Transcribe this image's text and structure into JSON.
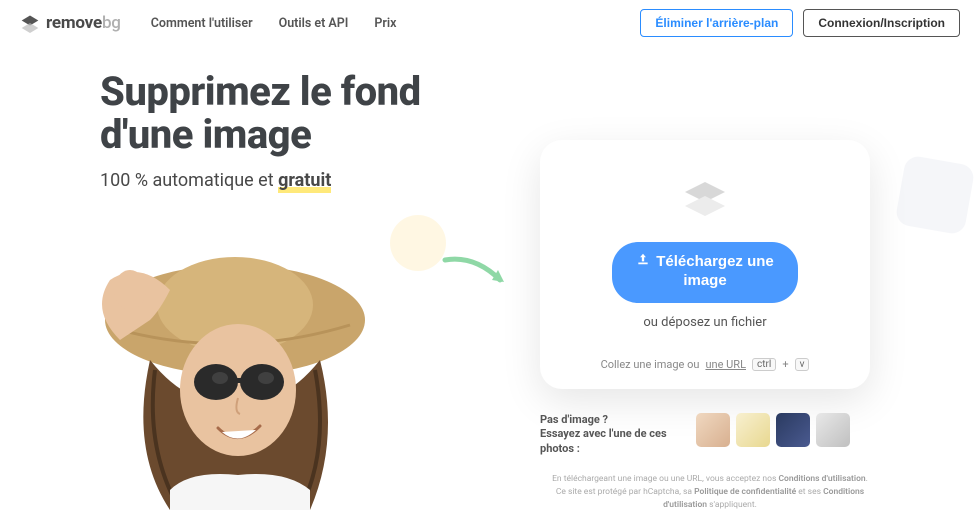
{
  "logo": {
    "part1": "remove",
    "part2": "bg"
  },
  "nav": {
    "how": "Comment l'utiliser",
    "tools": "Outils et API",
    "pricing": "Prix"
  },
  "header_buttons": {
    "remove_bg": "Éliminer l'arrière-plan",
    "login": "Connexion/Inscription"
  },
  "hero": {
    "title_line1": "Supprimez le fond",
    "title_line2": "d'une image",
    "sub_prefix": "100 % automatique et ",
    "sub_highlight": "gratuit"
  },
  "upload": {
    "button_line1": "Téléchargez une",
    "button_line2": "image",
    "drop_text": "ou déposez un fichier",
    "paste_prefix": "Collez une image ou ",
    "paste_link": "une URL",
    "kbd1": "ctrl",
    "kbd_plus": "+",
    "kbd2": "v"
  },
  "samples": {
    "line1": "Pas d'image ?",
    "line2": "Essayez avec l'une de ces photos :"
  },
  "legal": {
    "l1a": "En téléchargeant une image ou une URL, vous acceptez nos ",
    "l1b": "Conditions d'utilisation",
    "l1c": ".",
    "l2a": "Ce site est protégé par hCaptcha, sa ",
    "l2b": "Politique de confidentialité",
    "l2c": " et ses ",
    "l2d": "Conditions d'utilisation",
    "l2e": " s'appliquent."
  }
}
